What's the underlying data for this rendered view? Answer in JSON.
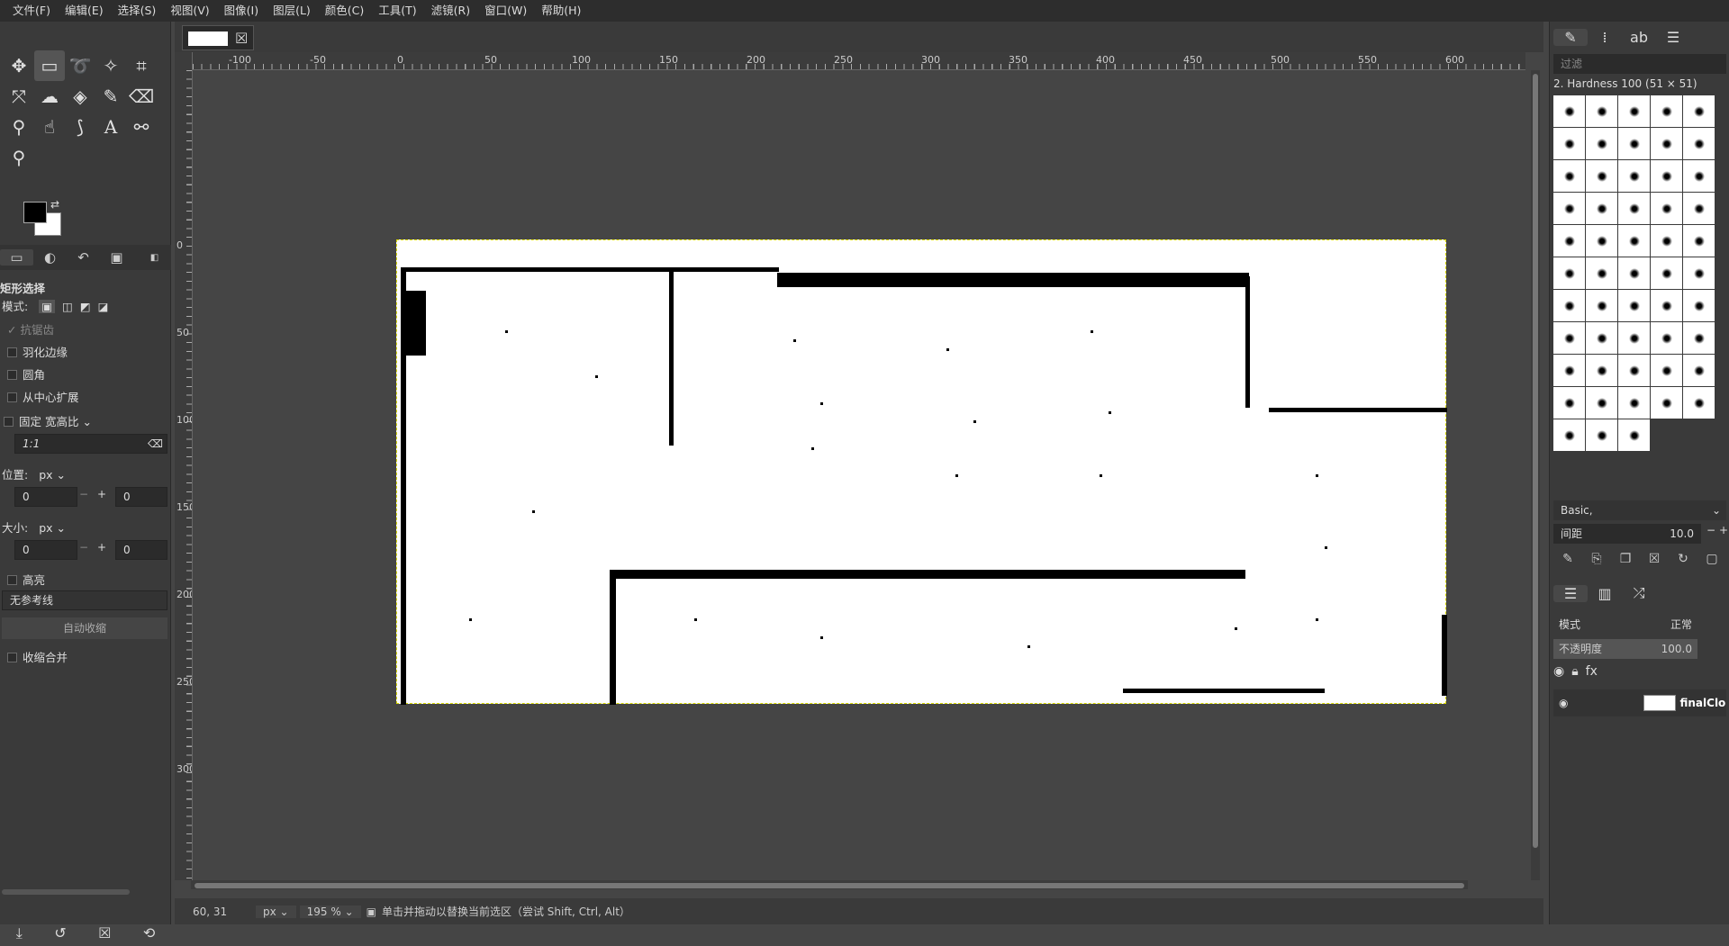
{
  "menu": [
    "文件(F)",
    "编辑(E)",
    "选择(S)",
    "视图(V)",
    "图像(I)",
    "图层(L)",
    "颜色(C)",
    "工具(T)",
    "滤镜(R)",
    "窗口(W)",
    "帮助(H)"
  ],
  "tool_options": {
    "title": "矩形选择",
    "mode_label": "模式:",
    "antialias": "抗锯齿",
    "feather": "羽化边缘",
    "rounded": "圆角",
    "expand_center": "从中心扩展",
    "fixed": "固定",
    "fixed_type": "宽高比",
    "ratio": "1:1",
    "position_label": "位置:",
    "position_unit": "px",
    "pos_x": "0",
    "pos_y": "0",
    "size_label": "大小:",
    "size_unit": "px",
    "size_w": "0",
    "size_h": "0",
    "highlight": "高亮",
    "guides": "无参考线",
    "auto_shrink": "自动收缩",
    "shrink_merged": "收缩合并"
  },
  "ruler": {
    "h_labels": [
      "-100",
      "-50",
      "0",
      "50",
      "100",
      "150",
      "200",
      "250",
      "300",
      "350",
      "400",
      "450",
      "500",
      "550",
      "600"
    ],
    "v_labels": [
      "0",
      "50",
      "100",
      "150",
      "200",
      "250",
      "300"
    ]
  },
  "status": {
    "coords": "60, 31",
    "unit": "px",
    "zoom": "195 %",
    "message": "单击并拖动以替换当前选区（尝试 Shift, Ctrl, Alt）"
  },
  "brushes": {
    "filter_placeholder": "过滤",
    "selected_name": "2. Hardness 100 (51 × 51)",
    "preset": "Basic,",
    "spacing_label": "间距",
    "spacing_value": "10.0"
  },
  "layers": {
    "mode_label": "模式",
    "mode_value": "正常",
    "opacity_label": "不透明度",
    "opacity_value": "100.0",
    "layer_name": "finalClo"
  }
}
